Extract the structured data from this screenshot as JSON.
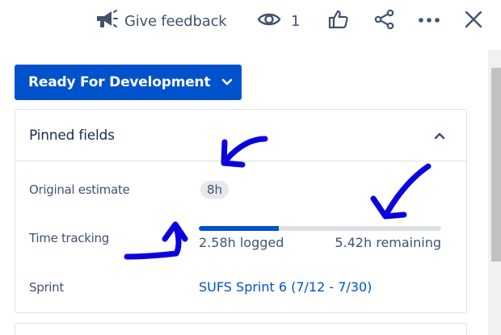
{
  "toolbar": {
    "feedback_label": "Give feedback",
    "watch_count": "1",
    "icons": [
      "megaphone-icon",
      "eye-icon",
      "thumbs-up-icon",
      "share-icon",
      "more-icon",
      "close-icon"
    ]
  },
  "status": {
    "label": "Ready For Development",
    "color": "#0052cc"
  },
  "pinned_fields": {
    "title": "Pinned fields",
    "original_estimate": {
      "label": "Original estimate",
      "value": "8h"
    },
    "time_tracking": {
      "label": "Time tracking",
      "logged": "2.58h logged",
      "remaining": "5.42h remaining",
      "progress_fraction": 0.33
    },
    "sprint": {
      "label": "Sprint",
      "value": "SUFS Sprint 6 (7/12 - 7/30)"
    }
  },
  "colors": {
    "accent": "#0052cc",
    "annotation": "#0a00e0",
    "text": "#42526e"
  }
}
